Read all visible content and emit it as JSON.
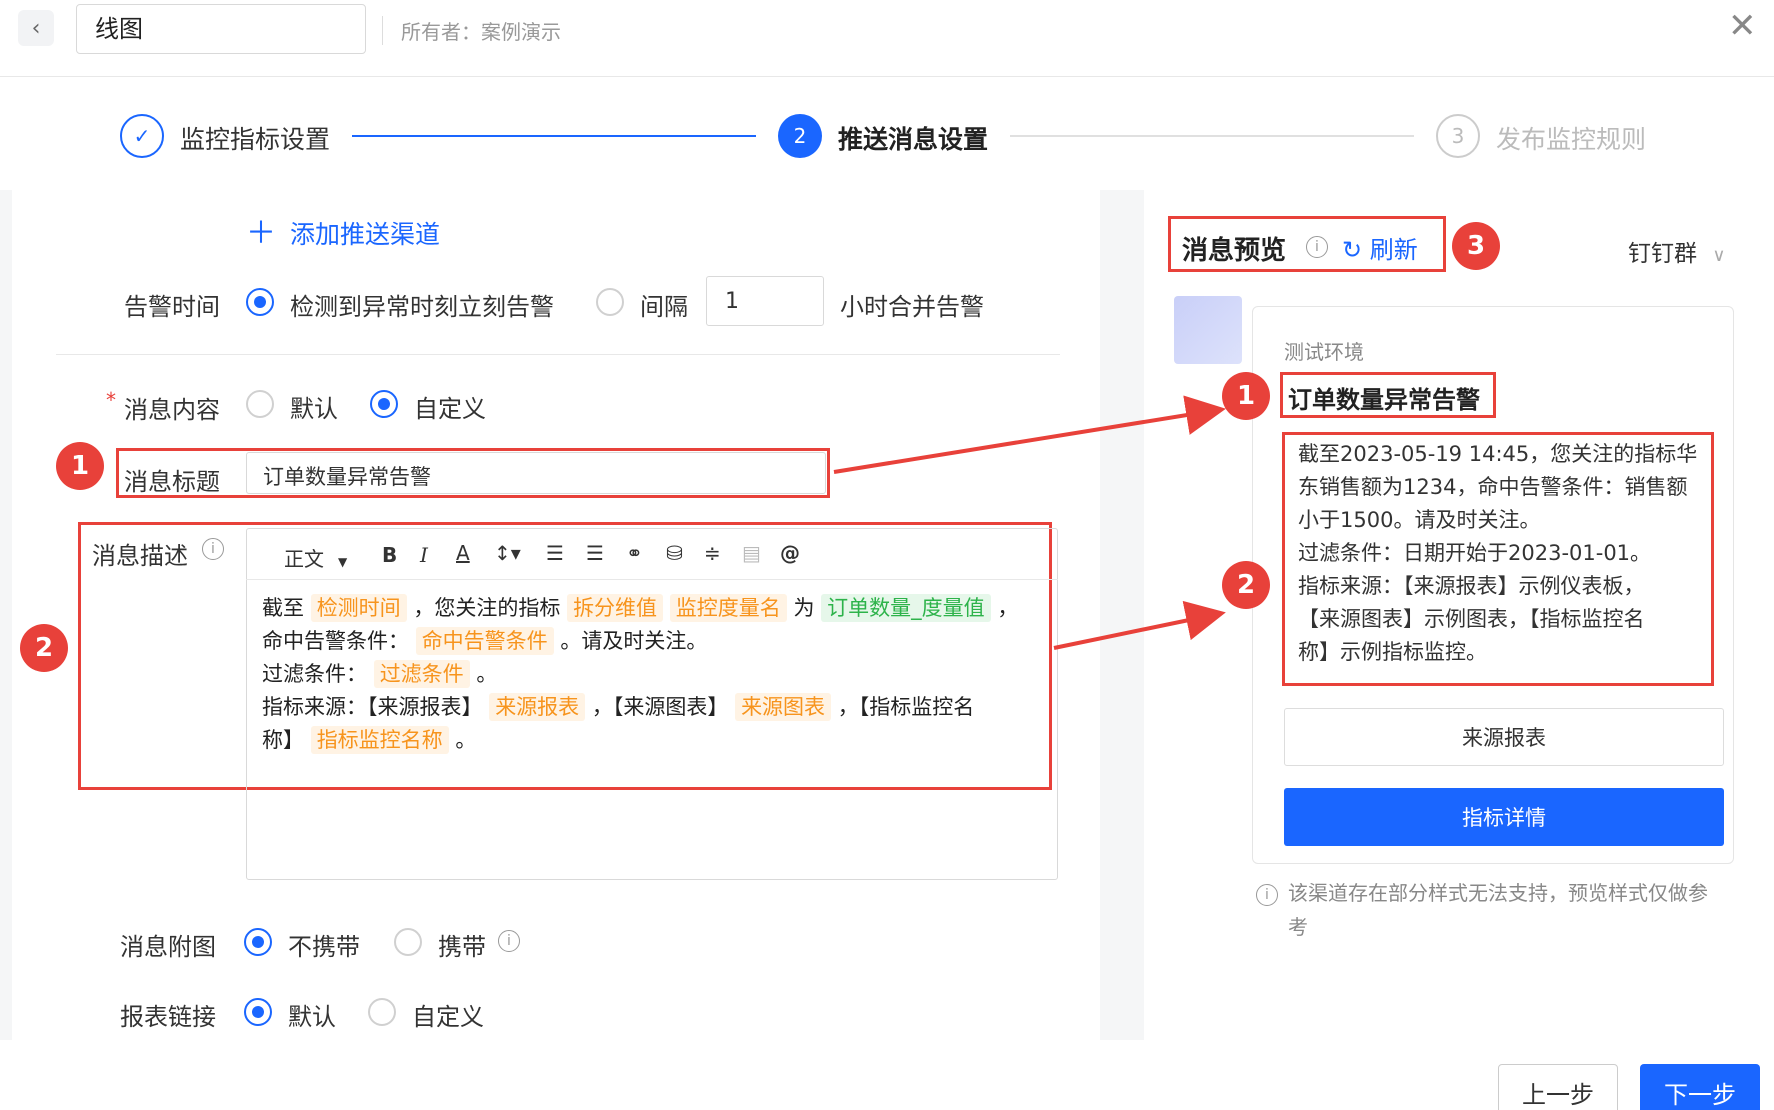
{
  "header": {
    "back_icon": "chevron-left-icon",
    "name_value": "线图",
    "owner": "所有者：案例演示",
    "close_icon": "close-icon"
  },
  "steps": [
    {
      "label": "监控指标设置",
      "state": "done",
      "num": ""
    },
    {
      "label": "推送消息设置",
      "state": "active",
      "num": "2"
    },
    {
      "label": "发布监控规则",
      "state": "pending",
      "num": "3"
    }
  ],
  "form": {
    "add_channel": "添加推送渠道",
    "alarm_time": {
      "label": "告警时间",
      "option1": "检测到异常时刻立刻告警",
      "option2": "间隔",
      "interval_value": "1",
      "suffix": "小时合并告警",
      "selected": "option1"
    },
    "message_content": {
      "label": "消息内容",
      "required_mark": "*",
      "option_default": "默认",
      "option_custom": "自定义",
      "selected": "custom"
    },
    "message_title": {
      "label": "消息标题",
      "value": "订单数量异常告警"
    },
    "message_desc": {
      "label": "消息描述",
      "toolbar": {
        "paragraph": "正文",
        "bold": "B",
        "italic": "I",
        "color": "A",
        "line_height": "‡",
        "at": "@"
      },
      "line1": {
        "t1": "截至",
        "tag1": "检测时间",
        "t2": "，您关注的指标",
        "tag2": "拆分维值",
        "tag3": "监控度量名",
        "t3": "为",
        "tag4": "订单数量_度量值",
        "t4": "，"
      },
      "line2": {
        "t1": "命中告警条件：",
        "tag1": "命中告警条件",
        "t2": "。请及时关注。"
      },
      "line3": {
        "t1": "过滤条件：",
        "tag1": "过滤条件",
        "t2": "。"
      },
      "line4": {
        "t1": "指标来源：【来源报表】",
        "tag1": "来源报表",
        "t2": "，【来源图表】",
        "tag2": "来源图表",
        "t3": "，【指标监控名"
      },
      "line5": {
        "t1": "称】",
        "tag1": "指标监控名称",
        "t2": "。"
      }
    },
    "attach_image": {
      "label": "消息附图",
      "option1": "不携带",
      "option2": "携带",
      "selected": "option1"
    },
    "report_link": {
      "label": "报表链接",
      "option1": "默认",
      "option2": "自定义",
      "selected": "option1"
    }
  },
  "preview": {
    "title": "消息预览",
    "refresh": "刷新",
    "channel": "钉钉群",
    "env": "测试环境",
    "msg_title": "订单数量异常告警",
    "body_lines": [
      "截至2023-05-19 14:45，您关注的指标华",
      "东销售额为1234，命中告警条件：销售额",
      "小于1500。请及时关注。",
      "过滤条件：日期开始于2023-01-01。",
      "指标来源：【来源报表】示例仪表板，",
      "【来源图表】示例图表，【指标监控名",
      "称】示例指标监控。"
    ],
    "btn_source": "来源报表",
    "btn_detail": "指标详情",
    "note_line1": "该渠道存在部分样式无法支持，预览样式仅做参",
    "note_line2": "考"
  },
  "annotations": {
    "badge1": "1",
    "badge2": "2",
    "badge3": "3",
    "color": "#e8413a"
  },
  "footer": {
    "prev": "上一步",
    "next": "下一步"
  },
  "colors": {
    "accent": "#1a66ff",
    "tag_orange": "#f7941d",
    "tag_green": "#2db34a"
  }
}
